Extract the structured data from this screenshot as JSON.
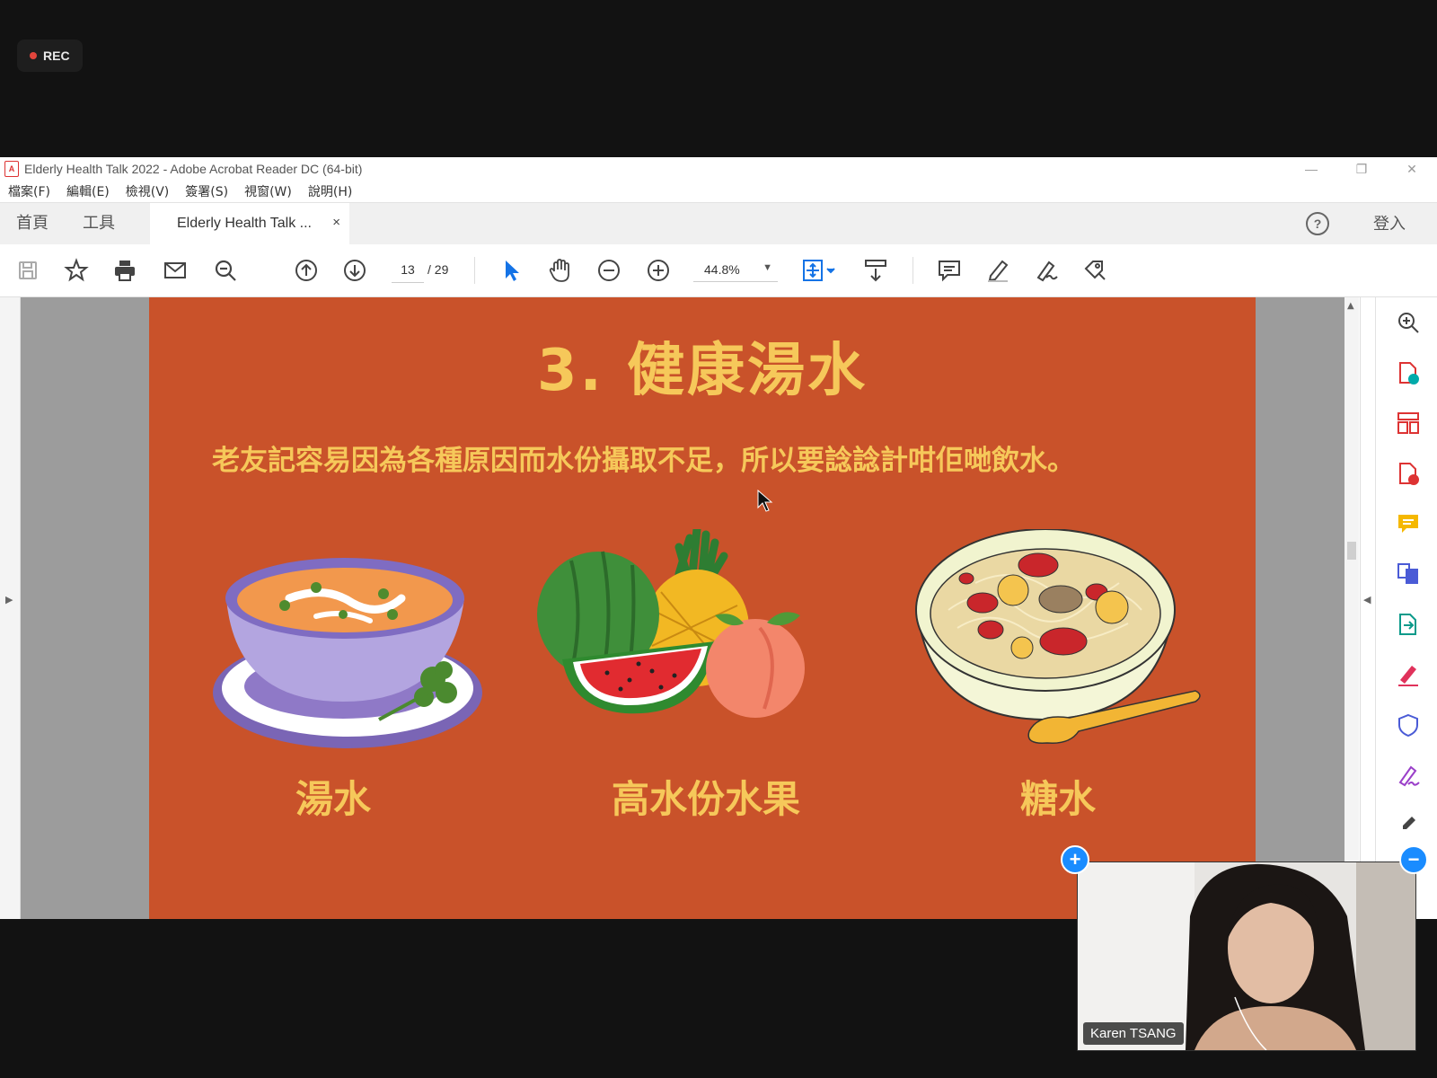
{
  "recording": {
    "label": "REC"
  },
  "window": {
    "title": "Elderly Health Talk 2022 - Adobe Acrobat Reader DC (64-bit)",
    "minimize_glyph": "—",
    "restore_glyph": "❐",
    "close_glyph": "✕"
  },
  "menu": [
    "檔案(F)",
    "編輯(E)",
    "檢視(V)",
    "簽署(S)",
    "視窗(W)",
    "說明(H)"
  ],
  "tabs": {
    "home": "首頁",
    "tools": "工具",
    "document": "Elderly Health Talk ...",
    "close_glyph": "×",
    "help_glyph": "?",
    "sign_in": "登入"
  },
  "toolbar": {
    "current_page": "13",
    "total_pages": "/ 29",
    "zoom": "44.8%"
  },
  "slide": {
    "title": "3.  健康湯水",
    "subtitle": "老友記容易因為各種原因而水份攝取不足，所以要諗諗計咁佢哋飲水。",
    "items": [
      {
        "label": "湯水"
      },
      {
        "label": "高水份水果"
      },
      {
        "label": "糖水"
      }
    ],
    "colors": {
      "background": "#c9522a",
      "text": "#f6c85a"
    }
  },
  "video": {
    "participant_name": "Karen TSANG",
    "add_glyph": "+",
    "remove_glyph": "−"
  },
  "icons": {
    "toolbar": [
      "save-icon",
      "bookmark-star-icon",
      "print-icon",
      "email-icon",
      "search-icon",
      "page-up-icon",
      "page-down-icon",
      "select-cursor-icon",
      "hand-icon",
      "zoom-out-icon",
      "zoom-in-icon",
      "fit-page-icon",
      "scroll-mode-icon",
      "comment-icon",
      "highlight-pen-icon",
      "sign-pen-icon",
      "share-icon"
    ],
    "right_panel": [
      "zoom-search-icon",
      "create-pdf-icon",
      "organize-pages-icon",
      "export-pdf-icon",
      "comment-icon",
      "combine-files-icon",
      "send-file-icon",
      "fill-sign-icon",
      "protect-icon",
      "sign-icon",
      "tools-more-icon"
    ]
  }
}
